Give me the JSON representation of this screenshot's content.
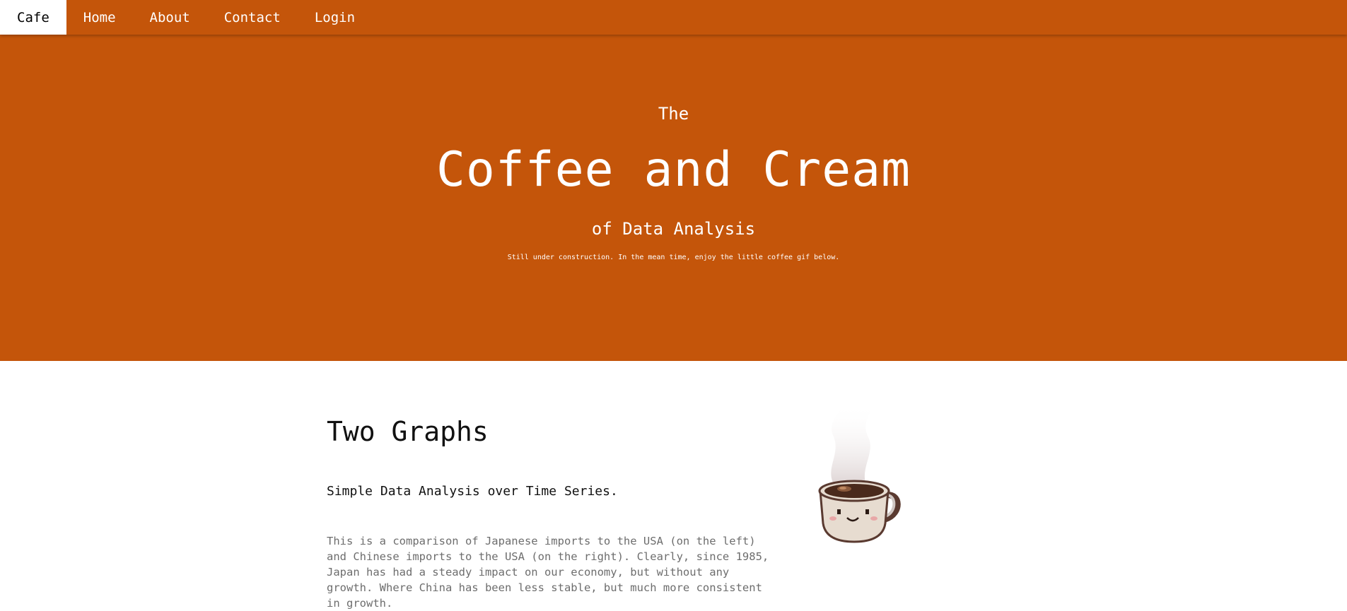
{
  "nav": {
    "brand": "Cafe",
    "items": [
      "Home",
      "About",
      "Contact",
      "Login"
    ]
  },
  "hero": {
    "pre_title": "The",
    "title": "Coffee and Cream",
    "subtitle": "of Data Analysis",
    "note": "Still under construction. In the mean time, enjoy the little coffee gif below."
  },
  "section": {
    "title": "Two Graphs",
    "subtitle": "Simple Data Analysis over Time Series.",
    "paragraph": "This is a comparison of Japanese imports to the USA (on the left) and Chinese imports to the USA (on the right). Clearly, since 1985, Japan has had a steady impact on our economy, but without any growth. Where China has been less stable, but much more consistent in growth."
  },
  "colors": {
    "accent": "#c4550a",
    "text_muted": "#6d6d6d"
  }
}
